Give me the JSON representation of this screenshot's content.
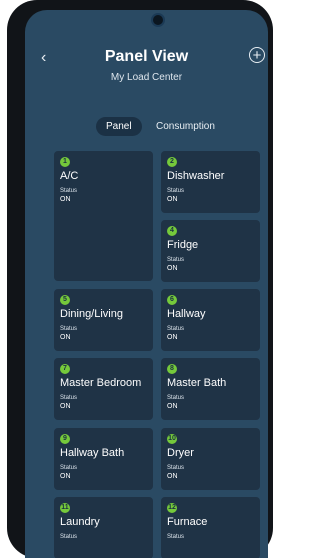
{
  "header": {
    "title": "Panel View",
    "subtitle": "My Load Center",
    "back_icon": "chevron-left-icon",
    "add_icon": "plus-circle-icon"
  },
  "tabs": [
    {
      "label": "Panel",
      "active": true
    },
    {
      "label": "Consumption",
      "active": false
    }
  ],
  "circuits": [
    {
      "number": "1",
      "name": "A/C",
      "status_label": "Status",
      "status": "ON"
    },
    {
      "number": "2",
      "name": "Dishwasher",
      "status_label": "Status",
      "status": "ON"
    },
    {
      "number": "4",
      "name": "Fridge",
      "status_label": "Status",
      "status": "ON"
    },
    {
      "number": "5",
      "name": "Dining/Living",
      "status_label": "Status",
      "status": "ON"
    },
    {
      "number": "6",
      "name": "Hallway",
      "status_label": "Status",
      "status": "ON"
    },
    {
      "number": "7",
      "name": "Master Bedroom",
      "status_label": "Status",
      "status": "ON"
    },
    {
      "number": "8",
      "name": "Master Bath",
      "status_label": "Status",
      "status": "ON"
    },
    {
      "number": "9",
      "name": "Hallway Bath",
      "status_label": "Status",
      "status": "ON"
    },
    {
      "number": "10",
      "name": "Dryer",
      "status_label": "Status",
      "status": "ON"
    },
    {
      "number": "11",
      "name": "Laundry",
      "status_label": "Status",
      "status": ""
    },
    {
      "number": "12",
      "name": "Furnace",
      "status_label": "Status",
      "status": ""
    }
  ],
  "colors": {
    "background": "#2a4a63",
    "card": "#1f3346",
    "badge": "#75c93b"
  }
}
